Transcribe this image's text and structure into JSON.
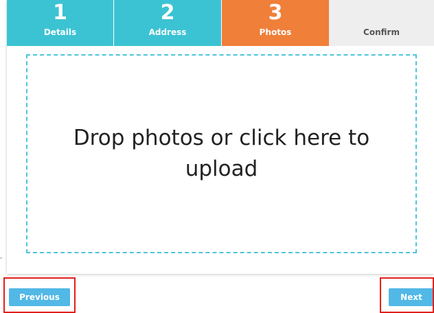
{
  "steps": [
    {
      "number": "1",
      "label": "Details"
    },
    {
      "number": "2",
      "label": "Address"
    },
    {
      "number": "3",
      "label": "Photos"
    },
    {
      "number": "",
      "label": "Confirm"
    }
  ],
  "active_step": 3,
  "colors": {
    "step_completed": "#3cc3d3",
    "step_active": "#f07f3a",
    "step_pending": "#eeeeee",
    "button": "#52b8e6",
    "dropzone_border": "#4fc3dd",
    "highlight": "#e0201c"
  },
  "dropzone": {
    "text": "Drop photos or click here to upload"
  },
  "buttons": {
    "previous": "Previous",
    "next": "Next"
  }
}
